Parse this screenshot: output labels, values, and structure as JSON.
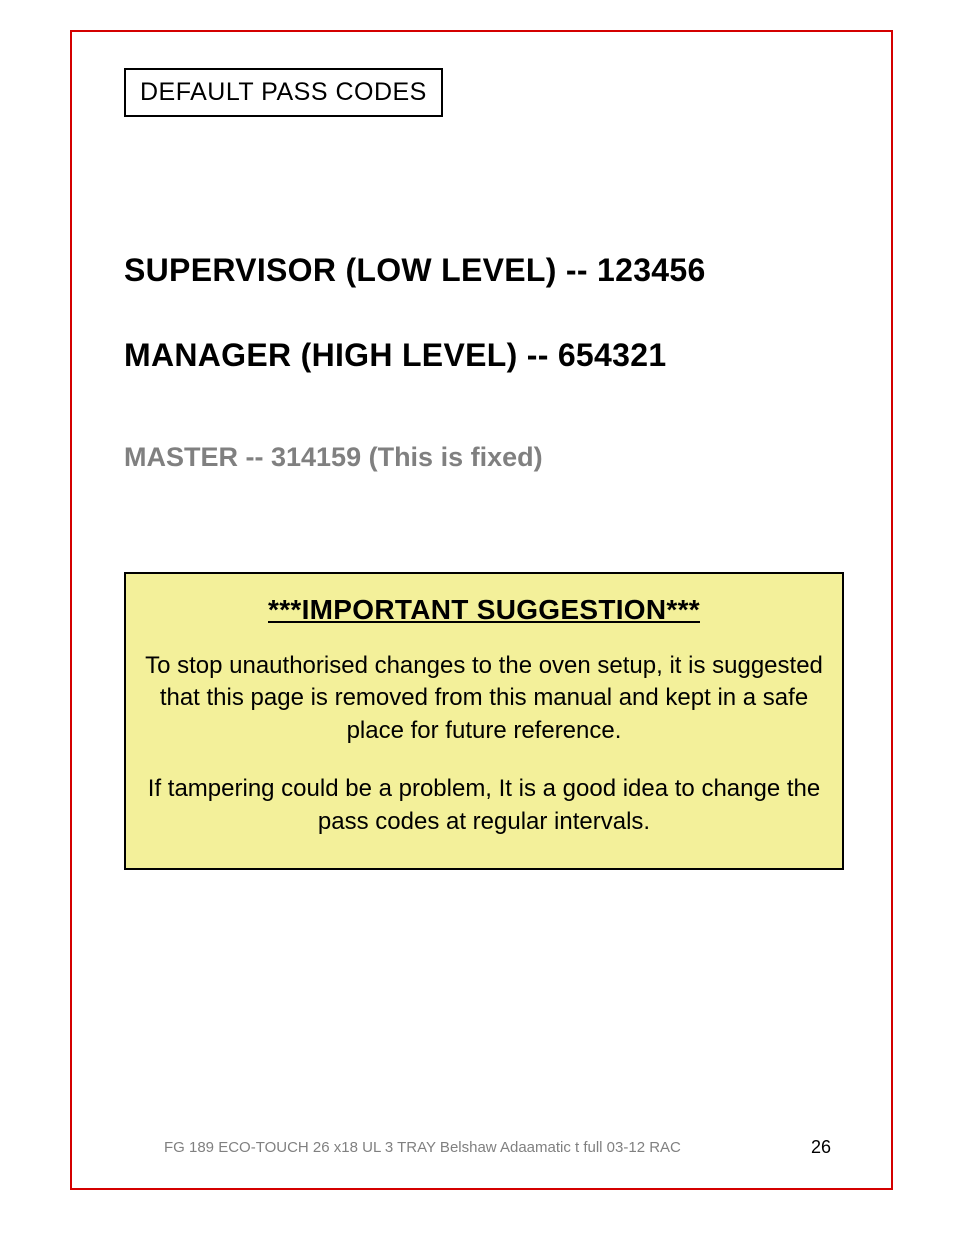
{
  "header": {
    "title": "DEFAULT PASS CODES"
  },
  "passcodes": {
    "supervisor": "SUPERVISOR (LOW LEVEL)  --  123456",
    "manager": "MANAGER (HIGH LEVEL)    --  654321",
    "master": "MASTER --  314159  (This is fixed)"
  },
  "callout": {
    "title": "***IMPORTANT   SUGGESTION***",
    "para1": "To stop unauthorised changes to the oven setup, it is suggested that this page is removed from this manual and kept in a safe place for future reference.",
    "para2": "If tampering could be a problem, It is a good idea to change the pass codes at regular intervals."
  },
  "footer": {
    "line": "FG 189 ECO-TOUCH 26 x18 UL 3 TRAY Belshaw Adaamatic t full 03-12 RAC",
    "page": "26"
  }
}
